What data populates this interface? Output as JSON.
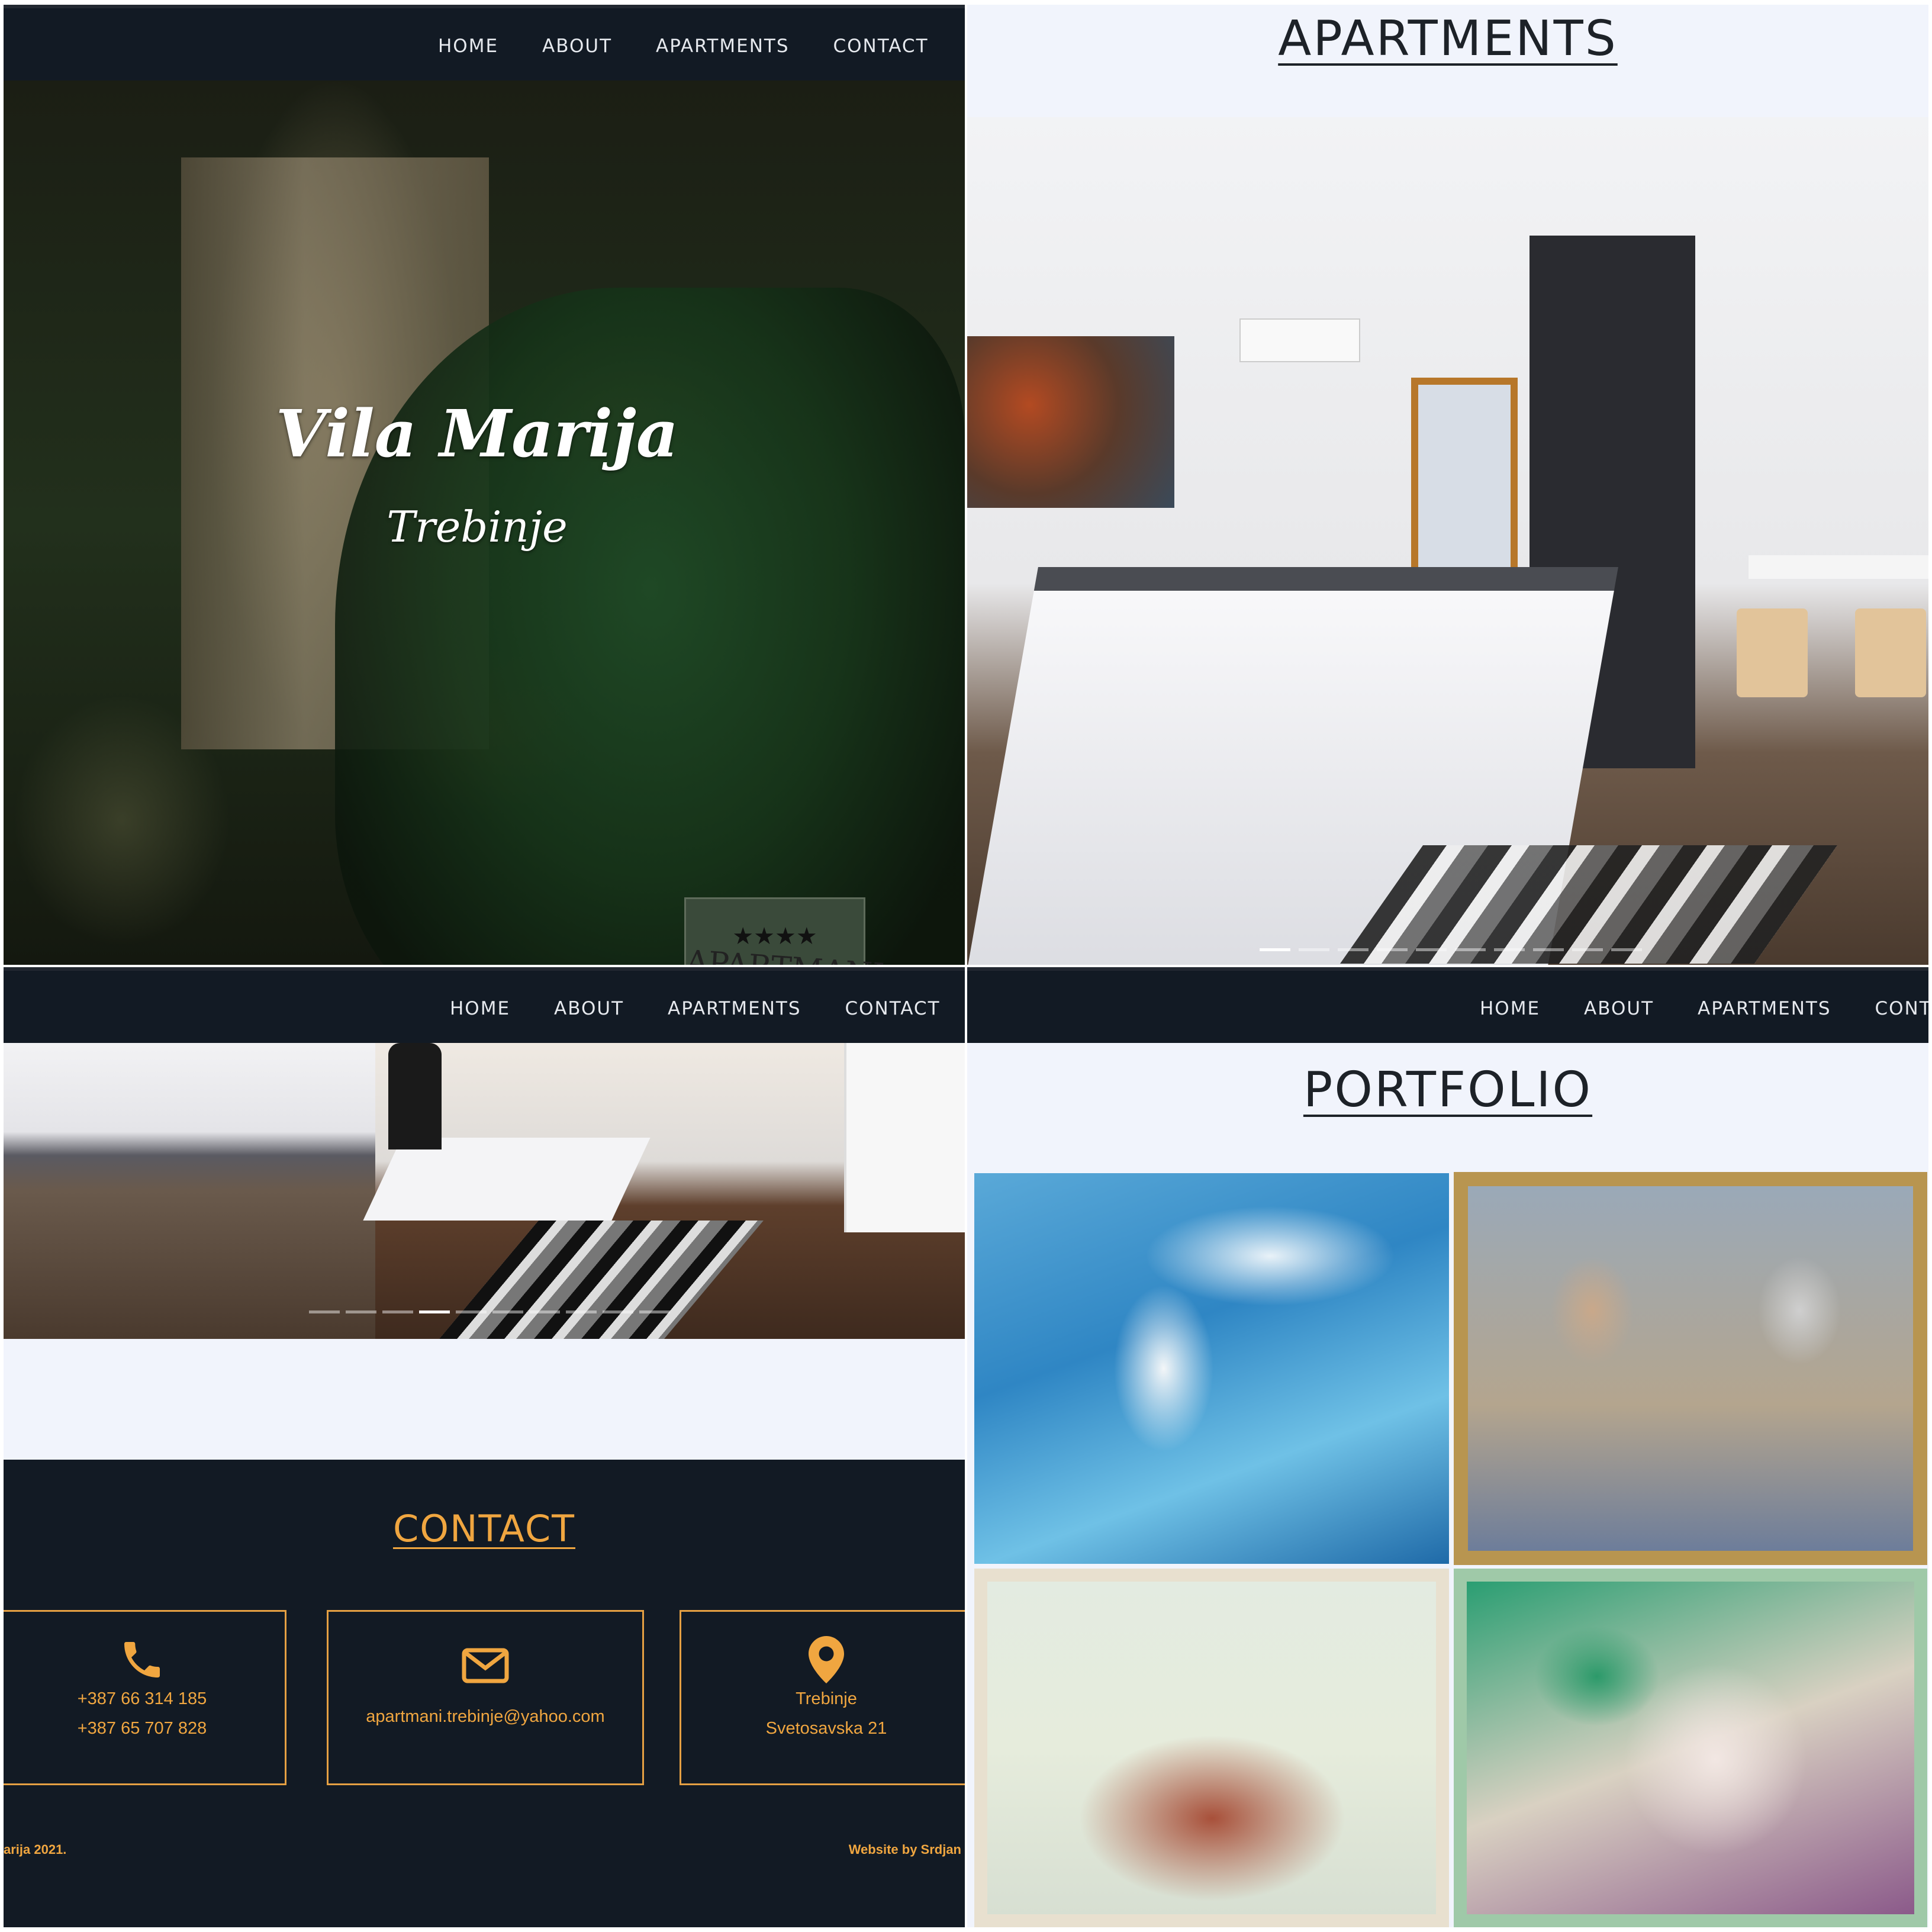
{
  "nav": {
    "items": [
      "HOME",
      "ABOUT",
      "APARTMENTS",
      "CONTACT"
    ],
    "items_truncated": [
      "HOME",
      "ABOUT",
      "APARTMENTS",
      "CONT"
    ]
  },
  "hero": {
    "title": "Vila Marija",
    "subtitle": "Trebinje",
    "sign_stars": "★★★★",
    "sign_text": "APARTMANI"
  },
  "apartments": {
    "title": "APARTMENTS",
    "slide_count": 10,
    "active_slide": 1
  },
  "slider2": {
    "slide_count": 10,
    "active_slide": 4
  },
  "contact": {
    "title": "CONTACT",
    "phone_1": "+387 66 314 185",
    "phone_2": "+387 65 707 828",
    "email": "apartmani.trebinje@yahoo.com",
    "city": "Trebinje",
    "street": "Svetosavska 21"
  },
  "footer": {
    "copyright": "arija 2021.",
    "credit": "Website by Srdjan"
  },
  "portfolio": {
    "title": "PORTFOLIO"
  },
  "colors": {
    "accent": "#f0a640",
    "navbar": "#121a24",
    "page_bg": "#f1f4fc"
  },
  "icons": {
    "phone": "phone-icon",
    "email": "envelope-icon",
    "location": "map-pin-icon"
  }
}
